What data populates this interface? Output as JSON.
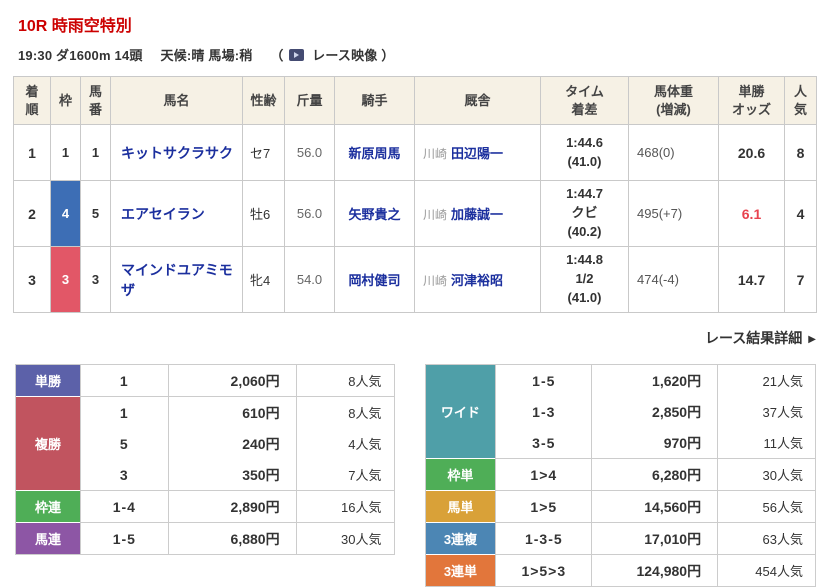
{
  "colors": {
    "title_red": "#cc0000",
    "link_blue": "#1b2f9e",
    "odds_hot_red": "#e8434f",
    "header_beige": "#f6f1e5",
    "bracket_blue": "#3d6eb5",
    "bracket_red": "#e25767"
  },
  "header": {
    "title": "10R 時雨空特別",
    "info": "19:30 ダ1600m 14頭",
    "weather": "天候:晴 馬場:稍",
    "paren_open": "（",
    "video_label": "レース映像",
    "paren_close": "）"
  },
  "results": {
    "columns": [
      "着\n順",
      "枠",
      "馬\n番",
      "馬名",
      "性齢",
      "斤量",
      "騎手",
      "厩舎",
      "タイム\n着差",
      "馬体重\n(増減)",
      "単勝\nオッズ",
      "人\n気"
    ],
    "rows": [
      {
        "finish": "1",
        "bracket": "1",
        "bracket_bg": "#ffffff",
        "bracket_fg": "#333333",
        "number": "1",
        "horse": "キットサクラサク",
        "sex_age": "セ7",
        "weight": "56.0",
        "jockey": "新原周馬",
        "stable_area": "川崎",
        "stable": "田辺陽一",
        "time_margin": "1:44.6\n(41.0)",
        "horse_weight": "468(0)",
        "odds": "20.6",
        "odds_color": "#333333",
        "popularity": "8"
      },
      {
        "finish": "2",
        "bracket": "4",
        "bracket_bg": "#3d6eb5",
        "bracket_fg": "#ffffff",
        "number": "5",
        "horse": "エアセイラン",
        "sex_age": "牡6",
        "weight": "56.0",
        "jockey": "矢野貴之",
        "stable_area": "川崎",
        "stable": "加藤誠一",
        "time_margin": "1:44.7\nクビ\n(40.2)",
        "horse_weight": "495(+7)",
        "odds": "6.1",
        "odds_color": "#e8434f",
        "popularity": "4"
      },
      {
        "finish": "3",
        "bracket": "3",
        "bracket_bg": "#e25767",
        "bracket_fg": "#ffffff",
        "number": "3",
        "horse": "マインドユアミモザ",
        "sex_age": "牝4",
        "weight": "54.0",
        "jockey": "岡村健司",
        "stable_area": "川崎",
        "stable": "河津裕昭",
        "time_margin": "1:44.8\n1/2\n(41.0)",
        "horse_weight": "474(-4)",
        "odds": "14.7",
        "odds_color": "#333333",
        "popularity": "7"
      }
    ]
  },
  "detail_link": {
    "label": "レース結果詳細",
    "arrow": "▶"
  },
  "payouts": {
    "left": [
      {
        "label": "単勝",
        "color": "#5c61a9",
        "rows": [
          {
            "combo": "1",
            "payout": "2,060円",
            "pop": "8人気"
          }
        ]
      },
      {
        "label": "複勝",
        "color": "#c1545f",
        "rows": [
          {
            "combo": "1",
            "payout": "610円",
            "pop": "8人気"
          },
          {
            "combo": "5",
            "payout": "240円",
            "pop": "4人気"
          },
          {
            "combo": "3",
            "payout": "350円",
            "pop": "7人気"
          }
        ]
      },
      {
        "label": "枠連",
        "color": "#4fae57",
        "rows": [
          {
            "combo": "1-4",
            "payout": "2,890円",
            "pop": "16人気"
          }
        ]
      },
      {
        "label": "馬連",
        "color": "#8d56a5",
        "rows": [
          {
            "combo": "1-5",
            "payout": "6,880円",
            "pop": "30人気"
          }
        ]
      }
    ],
    "right": [
      {
        "label": "ワイド",
        "color": "#4f9fa8",
        "rows": [
          {
            "combo": "1-5",
            "payout": "1,620円",
            "pop": "21人気"
          },
          {
            "combo": "1-3",
            "payout": "2,850円",
            "pop": "37人気"
          },
          {
            "combo": "3-5",
            "payout": "970円",
            "pop": "11人気"
          }
        ]
      },
      {
        "label": "枠単",
        "color": "#4fae57",
        "rows": [
          {
            "combo": "1>4",
            "payout": "6,280円",
            "pop": "30人気"
          }
        ]
      },
      {
        "label": "馬単",
        "color": "#d9a138",
        "rows": [
          {
            "combo": "1>5",
            "payout": "14,560円",
            "pop": "56人気"
          }
        ]
      },
      {
        "label": "3連複",
        "color": "#4c86b4",
        "rows": [
          {
            "combo": "1-3-5",
            "payout": "17,010円",
            "pop": "63人気"
          }
        ]
      },
      {
        "label": "3連単",
        "color": "#e2763b",
        "rows": [
          {
            "combo": "1>5>3",
            "payout": "124,980円",
            "pop": "454人気"
          }
        ]
      }
    ]
  }
}
